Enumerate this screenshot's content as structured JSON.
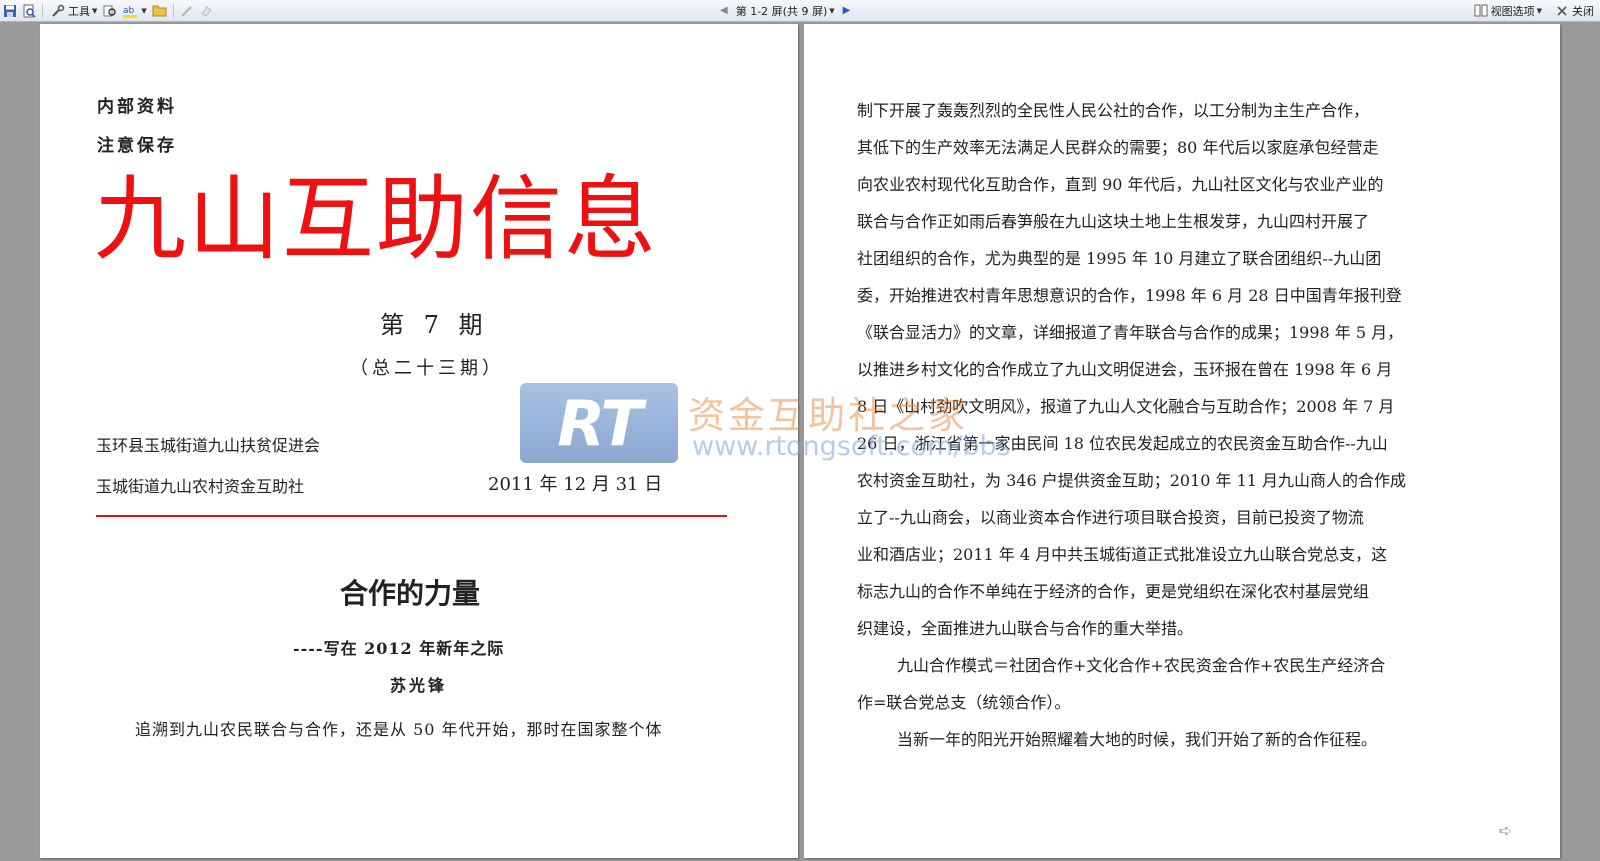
{
  "toolbar": {
    "tools_label": "工具",
    "page_indicator": "第 1-2 屏(共 9 屏)",
    "view_options_label": "视图选项",
    "close_label": "关闭"
  },
  "page1": {
    "confidential_1": "内部资料",
    "confidential_2": "注意保存",
    "masthead": "九山互助信息",
    "issue": "第 7 期",
    "issue_total": "（总二十三期）",
    "org_1": "玉环县玉城街道九山扶贫促进会",
    "org_2": "玉城街道九山农村资金互助社",
    "date": "2011 年 12 月 31 日",
    "article_title": "合作的力量",
    "subtitle": "----写在 2012 年新年之际",
    "author": "苏光锋",
    "para1": "追溯到九山农民联合与合作，还是从 50 年代开始，那时在国家整个体"
  },
  "page2": {
    "lines": [
      "制下开展了轰轰烈烈的全民性人民公社的合作，以工分制为主生产合作，",
      "其低下的生产效率无法满足人民群众的需要；80 年代后以家庭承包经营走",
      "向农业农村现代化互助合作，直到 90 年代后，九山社区文化与农业产业的",
      "联合与合作正如雨后春笋般在九山这块土地上生根发芽，九山四村开展了",
      "社团组织的合作，尤为典型的是 1995 年 10 月建立了联合团组织--九山团",
      "委，开始推进农村青年思想意识的合作，1998 年 6 月 28 日中国青年报刊登",
      "《联合显活力》的文章，详细报道了青年联合与合作的成果；1998 年 5 月，",
      "以推进乡村文化的合作成立了九山文明促进会，玉环报在曾在 1998 年 6 月",
      "8 日《山村劲吹文明风》，报道了九山人文化融合与互助合作；2008 年 7 月",
      "26 日，浙江省第一家由民间 18 位农民发起成立的农民资金互助合作--九山",
      "农村资金互助社，为 346 户提供资金互助；2010 年 11 月九山商人的合作成",
      "立了--九山商会，以商业资本合作进行项目联合投资，目前已投资了物流",
      "业和酒店业；2011 年 4 月中共玉城街道正式批准设立九山联合党总支，这",
      "标志九山的合作不单纯在于经济的合作，更是党组织在深化农村基层党组",
      "织建设，全面推进九山联合与合作的重大举措。",
      "九山合作模式＝社团合作+文化合作+农民资金合作+农民生产经济合",
      "作=联合党总支（统领合作）。",
      "当新一年的阳光开始照耀着大地的时候，我们开始了新的合作征程。"
    ]
  },
  "watermark": {
    "logo_text": "RT",
    "cn_text": "资金互助社之家",
    "url_text": "www.rtongsoft.com/bbs"
  }
}
